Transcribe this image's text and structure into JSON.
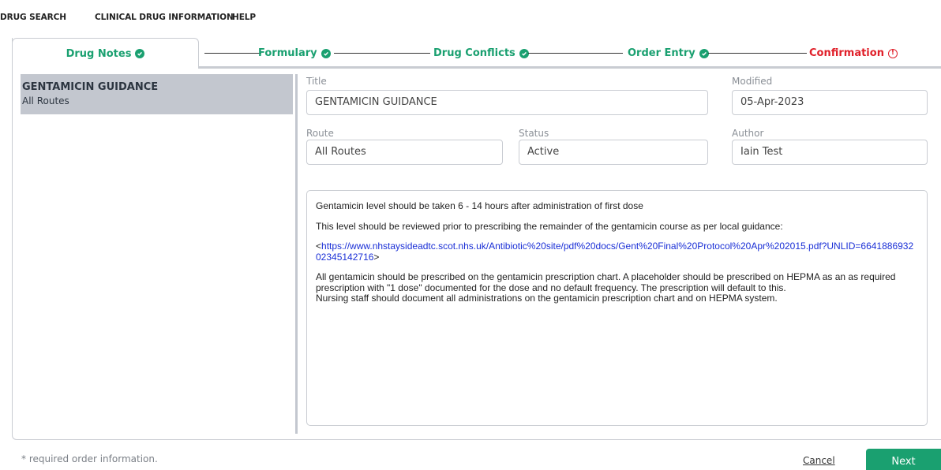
{
  "menu": {
    "items": [
      "DRUG SEARCH",
      "CLINICAL DRUG INFORMATION",
      "HELP"
    ]
  },
  "steps": [
    {
      "label": "Drug Notes",
      "status": "complete"
    },
    {
      "label": "Formulary",
      "status": "complete"
    },
    {
      "label": "Drug Conflicts",
      "status": "complete"
    },
    {
      "label": "Order Entry",
      "status": "complete"
    },
    {
      "label": "Confirmation",
      "status": "error"
    }
  ],
  "notes_list": [
    {
      "title": "GENTAMICIN GUIDANCE",
      "subtitle": "All Routes"
    }
  ],
  "form": {
    "title_label": "Title",
    "title_value": "GENTAMICIN GUIDANCE",
    "modified_label": "Modified",
    "modified_value": "05-Apr-2023",
    "route_label": "Route",
    "route_value": "All Routes",
    "status_label": "Status",
    "status_value": "Active",
    "author_label": "Author",
    "author_value": "Iain Test"
  },
  "note_body": {
    "p1": "Gentamicin level should be taken 6 - 14 hours after administration of first dose",
    "p2": "This level should be reviewed prior to prescribing the remainder of the gentamicin course as per local guidance:",
    "link_prefix": "<",
    "link": "https://www.nhstaysideadtc.scot.nhs.uk/Antibiotic%20site/pdf%20docs/Gent%20Final%20Protocol%20Apr%202015.pdf?UNLID=664188693202345142716",
    "link_suffix": ">",
    "p3": "All gentamicin should be prescribed on the gentamicin prescription chart. A placeholder should be prescribed on HEPMA as an as required prescription with \"1 dose\" documented for the dose and no default frequency. The prescription will default to this.",
    "p4": "Nursing staff should document all administrations on the gentamicin prescription chart and on HEPMA system."
  },
  "footer": {
    "required_note": "* required order information.",
    "cancel_label": "Cancel",
    "next_label": "Next"
  },
  "colors": {
    "accent": "#1aa070",
    "error": "#e0202a",
    "selected_item": "#c3c7cf",
    "link": "#1a2fd6"
  },
  "icons": {
    "complete": "check-circle-icon",
    "error": "alert-circle-icon"
  }
}
